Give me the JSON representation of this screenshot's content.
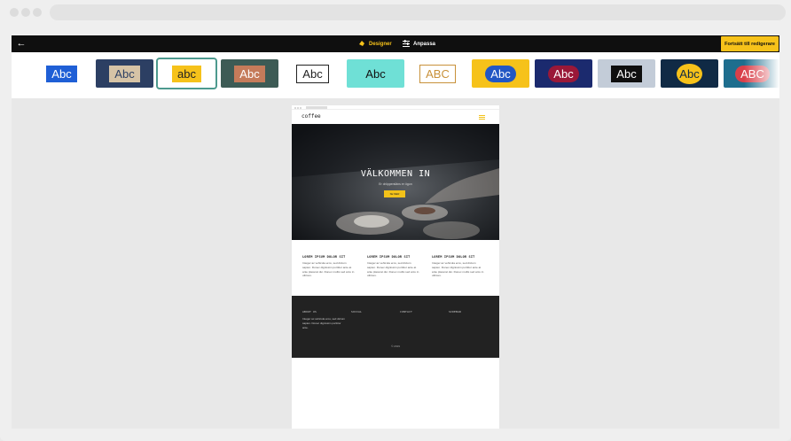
{
  "topbar": {
    "tabs": [
      {
        "label": "Designer",
        "icon": "palette-icon",
        "active": true
      },
      {
        "label": "Anpassa",
        "icon": "sliders-icon",
        "active": false
      }
    ],
    "cta_label": "Fortsätt till redigerare"
  },
  "themes": [
    {
      "text": "Abc",
      "bg": "#ffffff",
      "chip_bg": "#1f5fd6",
      "chip_fg": "#ffffff",
      "selected": false
    },
    {
      "text": "Abc",
      "bg": "#2c3f63",
      "chip_bg": "#d6c3a6",
      "chip_fg": "#2c3f63",
      "selected": false
    },
    {
      "text": "abc",
      "bg": "#ffffff",
      "chip_bg": "#f6c21a",
      "chip_fg": "#222222",
      "selected": true
    },
    {
      "text": "Abc",
      "bg": "#3d5b55",
      "chip_bg": "#c57b5a",
      "chip_fg": "#ffffff",
      "selected": false
    },
    {
      "text": "Abc",
      "bg": "#ffffff",
      "chip_bg": "#ffffff",
      "chip_fg": "#222222",
      "selected": false
    },
    {
      "text": "Abc",
      "bg": "#6fe0d6",
      "chip_bg": "#6fe0d6",
      "chip_fg": "#111111",
      "selected": false
    },
    {
      "text": "ABC",
      "bg": "#ffffff",
      "chip_bg": "#ffffff",
      "chip_fg": "#c8913a",
      "selected": false
    },
    {
      "text": "Abc",
      "bg": "#f6c21a",
      "chip_bg": "#2257c4",
      "chip_fg": "#ffffff",
      "selected": false
    },
    {
      "text": "Abc",
      "bg": "#1b2a6e",
      "chip_bg": "#9a1838",
      "chip_fg": "#ffffff",
      "selected": false
    },
    {
      "text": "Abc",
      "bg": "#c3ccd8",
      "chip_bg": "#0f0f0f",
      "chip_fg": "#ffffff",
      "selected": false
    },
    {
      "text": "Abc",
      "bg": "#102a45",
      "chip_bg": "#f6c21a",
      "chip_fg": "#102a45",
      "selected": false
    },
    {
      "text": "ABC",
      "bg": "#1e6e8e",
      "chip_bg": "#d9404a",
      "chip_fg": "#ffffff",
      "selected": false
    }
  ],
  "preview": {
    "logo": "coffee",
    "hero_title": "VÄLKOMMEN IN",
    "hero_subtitle": "Er dröppersläns er ögon",
    "hero_button": "SE MER",
    "columns": [
      {
        "title": "LOREM IPSUM DOLOR SIT",
        "text": "Integer ac vehicula eros, sed dictum sapien. Donec dignissim porttitor ante at ante placerat dui. Donec mollis sed arcu in ultrices."
      },
      {
        "title": "LOREM IPSUM DOLOR SIT",
        "text": "Integer ac vehicula eros, sed dictum sapien. Donec dignissim porttitor ante at ante placerat dui. Donec mollis sed arcu in ultrices."
      },
      {
        "title": "LOREM IPSUM DOLOR SIT",
        "text": "Integer ac vehicula eros, sed dictum sapien. Donec dignissim porttitor ante at ante placerat dui. Donec mollis sed arcu in ultrices."
      }
    ],
    "footer": {
      "headings": [
        "ABOUT US",
        "SOCIAL",
        "CONTACT",
        "SIDEBAR"
      ],
      "text": "Integer ac vehicula eros, sed dictum sapien. Donec dignissim porttitor ante.",
      "copyright": "© 2019"
    }
  },
  "colors": {
    "accent": "#f6c21a",
    "topbar": "#0f0f0f",
    "selection": "#4d9a8e"
  }
}
